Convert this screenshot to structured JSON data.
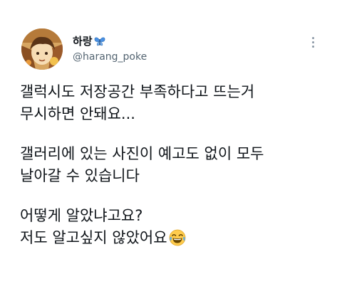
{
  "user": {
    "display_name": "하랑",
    "handle": "@harang_poke",
    "name_icon": "butterfly-icon",
    "avatar_icon": "anime-avatar"
  },
  "tweet": {
    "paragraphs": [
      [
        "갤럭시도 저장공간 부족하다고 뜨는거",
        "무시하면 안돼요..."
      ],
      [
        "갤러리에 있는 사진이 예고도 없이 모두",
        "날아갈 수 있습니다"
      ],
      [
        "어떻게 알았냐고요?",
        "저도 알고싶지 않았어요"
      ]
    ],
    "trailing_emoji": "laughing-crying-emoji"
  },
  "colors": {
    "text": "#0f1419",
    "secondary": "#536471",
    "butterfly": "#4a90e2",
    "more_dots": "#8b98a5"
  }
}
